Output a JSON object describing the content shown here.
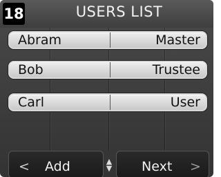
{
  "header": {
    "page_number": "18",
    "title": "USERS LIST"
  },
  "users": [
    {
      "name": "Abram",
      "role": "Master"
    },
    {
      "name": "Bob",
      "role": "Trustee"
    },
    {
      "name": "Carl",
      "role": "User"
    }
  ],
  "footer": {
    "add_chevron": "<",
    "add_label": "Add",
    "next_label": "Next",
    "next_chevron": ">",
    "scroll_icon": "up-down-arrows-icon"
  },
  "colors": {
    "background": "#3a3a3a",
    "row_fill": "#dedede",
    "text_light": "#f2f2f2",
    "page_badge": "#000000"
  }
}
